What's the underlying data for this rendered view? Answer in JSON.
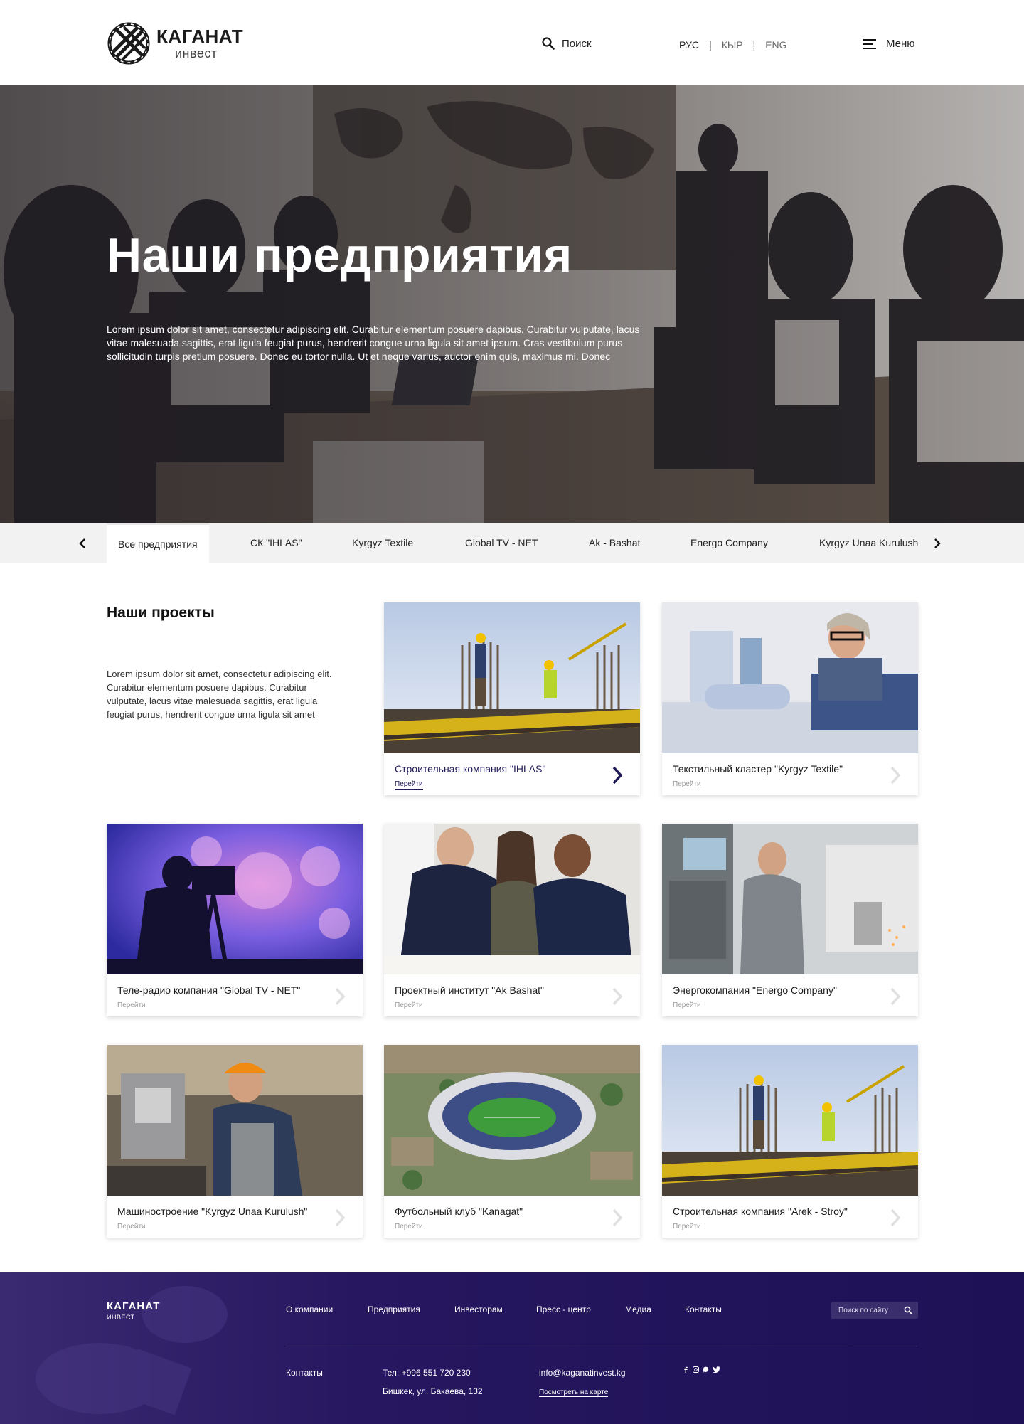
{
  "header": {
    "logo_title": "КАГАНАТ",
    "logo_sub": "инвест",
    "search_label": "Поиск",
    "languages": [
      "РУС",
      "КЫР",
      "ENG"
    ],
    "menu_label": "Меню"
  },
  "hero": {
    "title": "Наши предприятия",
    "text": "Lorem ipsum dolor sit amet, consectetur adipiscing elit. Curabitur elementum posuere dapibus. Curabitur vulputate, lacus vitae malesuada sagittis, erat ligula feugiat purus, hendrerit congue urna ligula sit amet ipsum. Cras vestibulum purus sollicitudin turpis pretium posuere. Donec eu tortor nulla. Ut et neque varius, auctor enim quis, maximus mi. Donec"
  },
  "tabs": [
    {
      "label": "Все предприятия"
    },
    {
      "label": "СК \"IHLAS\""
    },
    {
      "label": "Kyrgyz Textile"
    },
    {
      "label": "Global TV - NET"
    },
    {
      "label": "Ak - Bashat"
    },
    {
      "label": "Energo Company"
    },
    {
      "label": "Kyrgyz Unaa Kurulush"
    }
  ],
  "projects": {
    "title": "Наши проекты",
    "text": "Lorem ipsum dolor sit amet, consectetur adipiscing elit. Curabitur elementum posuere dapibus. Curabitur vulputate, lacus vitae malesuada sagittis, erat ligula feugiat purus, hendrerit congue urna ligula sit amet",
    "link_label": "Перейти",
    "cards": [
      {
        "title": "Строительная компания \"IHLAS\""
      },
      {
        "title": "Текстильный кластер \"Kyrgyz Textile\""
      },
      {
        "title": "Теле-радио компания \"Global TV - NET\""
      },
      {
        "title": "Проектный институт \"Ak Bashat\""
      },
      {
        "title": "Энергокомпания \"Energo Company\""
      },
      {
        "title": "Машиностроение \"Kyrgyz Unaa Kurulush\""
      },
      {
        "title": "Футбольный клуб \"Kanagat\""
      },
      {
        "title": "Строительная компания \"Arek - Stroy\""
      }
    ]
  },
  "footer": {
    "logo_title": "КАГАНАТ",
    "logo_sub": "ИНВЕСТ",
    "nav": [
      "О компании",
      "Предприятия",
      "Инвесторам",
      "Пресс - центр",
      "Медиа",
      "Контакты"
    ],
    "search_placeholder": "Поиск по сайту",
    "contacts_label": "Контакты",
    "phone": "Тел: +996 551 720 230",
    "address": "Бишкек, ул. Бакаева, 132",
    "email": "info@kaganatinvest.kg",
    "map_link": "Посмотреть на карте",
    "socials": [
      "facebook-icon",
      "instagram-icon",
      "whatsapp-icon",
      "twitter-icon"
    ]
  },
  "colors": {
    "brand_dark": "#241659",
    "accent": "#1f1a55",
    "tab_bar": "#f2f2f2"
  }
}
